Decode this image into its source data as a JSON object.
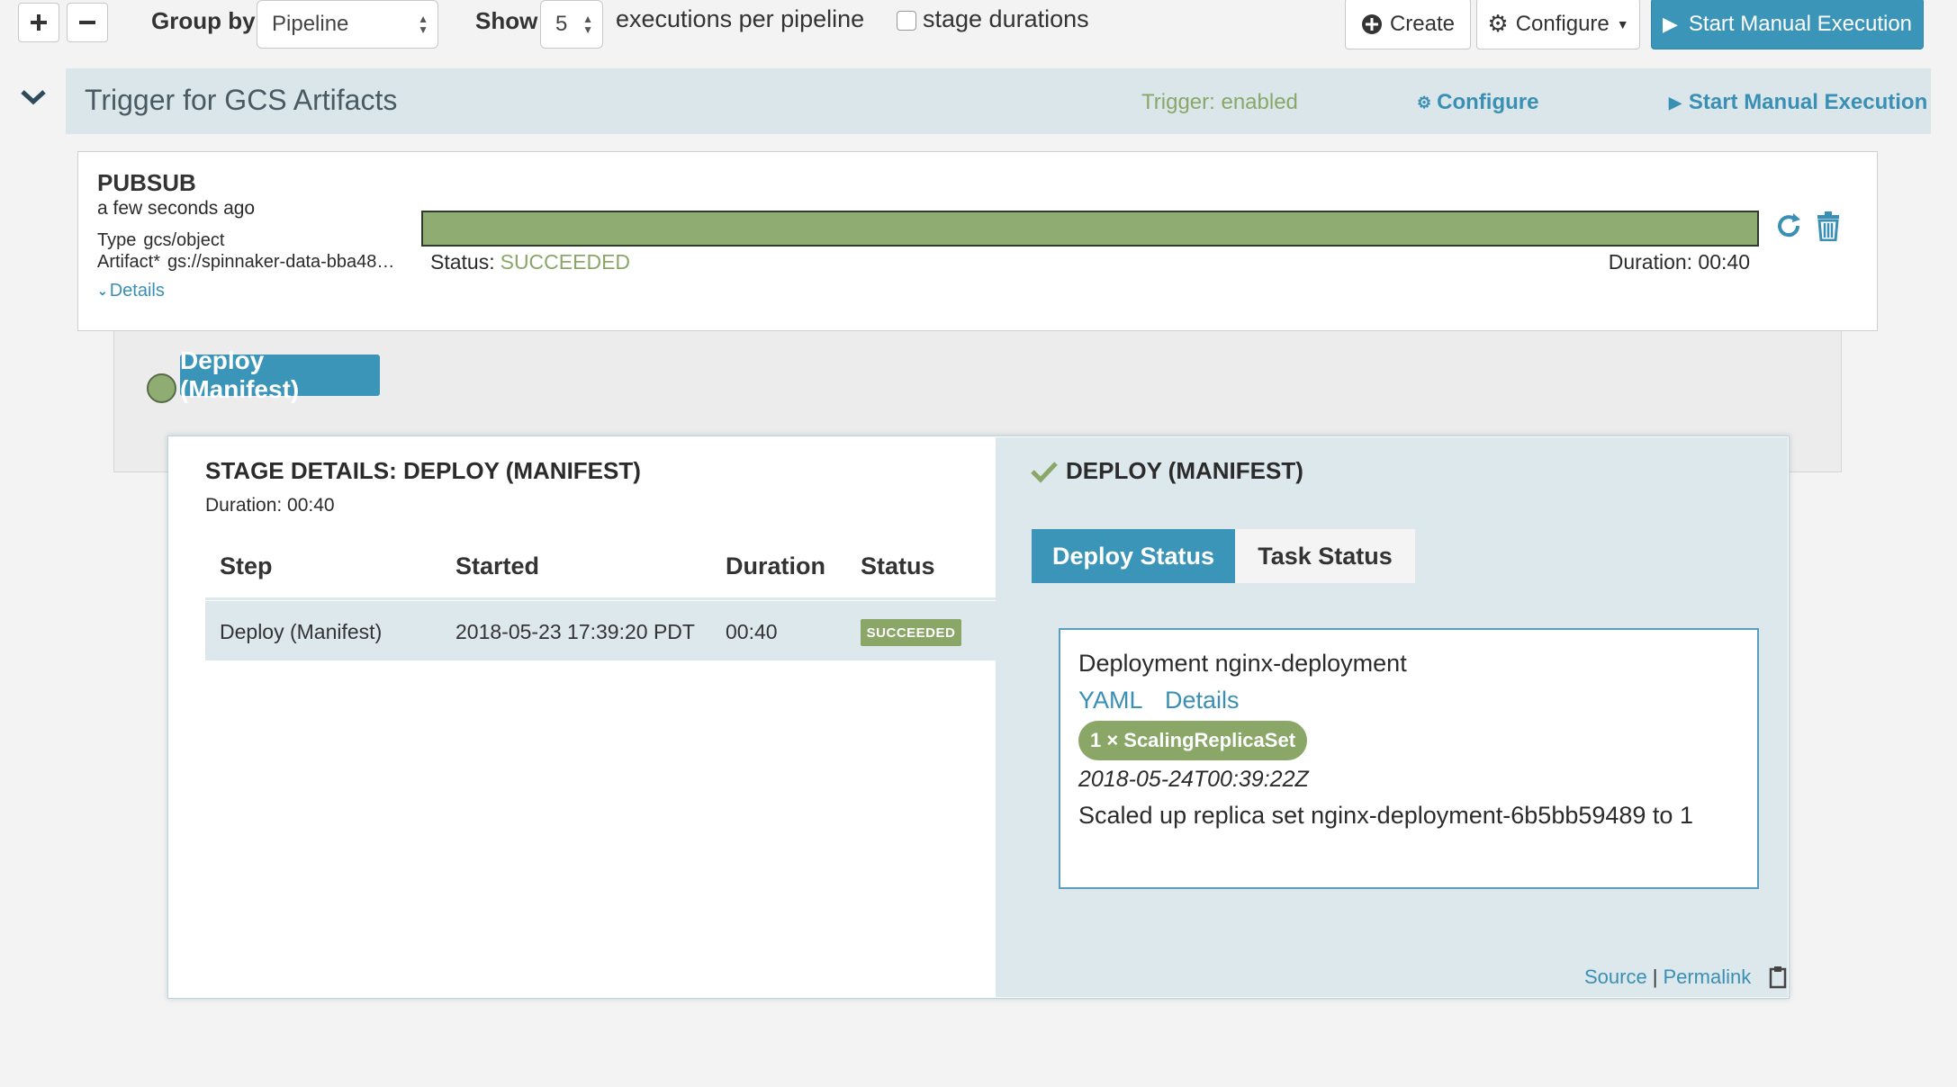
{
  "toolbar": {
    "group_by_label": "Group by",
    "group_by_value": "Pipeline",
    "show_label": "Show",
    "show_value": "5",
    "executions_label": "executions per pipeline",
    "stage_durations_label": "stage durations",
    "create_label": "Create",
    "configure_label": "Configure",
    "start_manual_label": "Start Manual Execution"
  },
  "pipeline": {
    "title": "Trigger for GCS Artifacts",
    "trigger_status": "Trigger: enabled",
    "configure_label": "Configure",
    "start_manual_label": "Start Manual Execution"
  },
  "execution": {
    "trigger_type": "PUBSUB",
    "time_ago": "a few seconds ago",
    "type_label": "Type",
    "type_value": "gcs/object",
    "artifact_label": "Artifact*",
    "artifact_value": "gs://spinnaker-data-bba48…",
    "details_link": "Details",
    "status_label": "Status:",
    "status_value": "SUCCEEDED",
    "duration_text": "Duration: 00:40",
    "progress": 1.0
  },
  "stage": {
    "label": "Deploy (Manifest)"
  },
  "stage_details": {
    "title": "STAGE DETAILS: DEPLOY (MANIFEST)",
    "duration_text": "Duration: 00:40",
    "columns": [
      "Step",
      "Started",
      "Duration",
      "Status"
    ],
    "rows": [
      {
        "step": "Deploy (Manifest)",
        "started": "2018-05-23 17:39:20 PDT",
        "duration": "00:40",
        "status": "SUCCEEDED"
      }
    ]
  },
  "deploy_panel": {
    "title": "DEPLOY (MANIFEST)",
    "tabs": [
      "Deploy Status",
      "Task Status"
    ],
    "deployment_name": "Deployment nginx-deployment",
    "yaml_link": "YAML",
    "details_link": "Details",
    "event_count_reason": "1 × ScalingReplicaSet",
    "event_timestamp": "2018-05-24T00:39:22Z",
    "event_message": "Scaled up replica set nginx-deployment-6b5bb59489 to 1",
    "source_link": "Source",
    "separator": "|",
    "permalink_link": "Permalink"
  },
  "colors": {
    "accent": "#3a95b9",
    "success": "#8aa768",
    "header_bg": "#dbe6ea"
  }
}
